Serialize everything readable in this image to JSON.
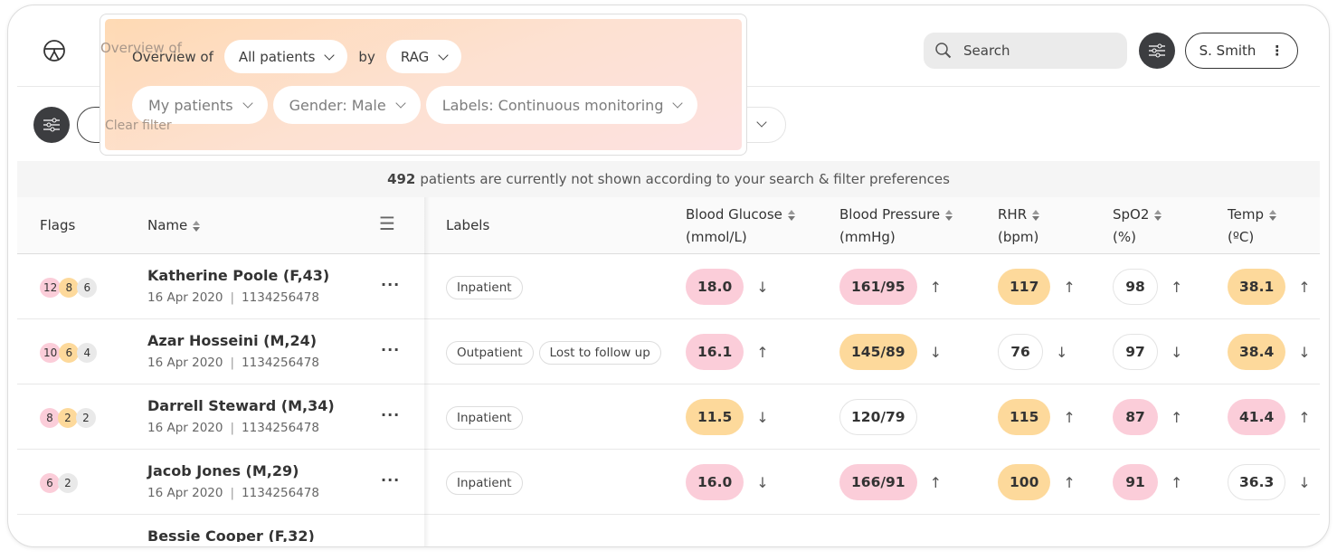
{
  "header": {
    "overview_label": "Overview of",
    "search_placeholder": "Search",
    "user": "S. Smith",
    "clear_filter": "Clear filter"
  },
  "overview": {
    "prefix": "Overview of",
    "scope": "All patients",
    "by": "by",
    "mode": "RAG",
    "filters": [
      "My patients",
      "Gender: Male",
      "Labels: Continuous monitoring"
    ]
  },
  "info": {
    "count": "492",
    "text": "patients are currently not shown according to your search & filter preferences"
  },
  "columns": {
    "flags": "Flags",
    "name": "Name",
    "labels": "Labels",
    "glucose": [
      "Blood Glucose",
      "(mmol/L)"
    ],
    "bp": [
      "Blood Pressure",
      "(mmHg)"
    ],
    "rhr": [
      "RHR",
      "(bpm)"
    ],
    "spo2": [
      "SpO2",
      "(%)"
    ],
    "temp": [
      "Temp",
      "(ºC)"
    ]
  },
  "colors": {
    "pink": "#fbcdd9",
    "orange": "#fdd99b",
    "gray": "#e9e9e9",
    "dark": "#3c3d40"
  },
  "patients": [
    {
      "name": "Katherine Poole (F,43)",
      "date": "16 Apr 2020",
      "id": "1134256478",
      "flags": [
        {
          "v": "12",
          "c": "pink"
        },
        {
          "v": "8",
          "c": "orange"
        },
        {
          "v": "6",
          "c": "gray"
        }
      ],
      "labels": [
        "Inpatient"
      ],
      "vitals": [
        {
          "v": "18.0",
          "c": "pink",
          "t": "↓"
        },
        {
          "v": "161/95",
          "c": "pink",
          "t": "↑"
        },
        {
          "v": "117",
          "c": "orange",
          "t": "↑"
        },
        {
          "v": "98",
          "c": "white",
          "t": "↑"
        },
        {
          "v": "38.1",
          "c": "orange",
          "t": "↑"
        }
      ]
    },
    {
      "name": "Azar Hosseini (M,24)",
      "date": "16 Apr 2020",
      "id": "1134256478",
      "flags": [
        {
          "v": "10",
          "c": "pink"
        },
        {
          "v": "6",
          "c": "orange"
        },
        {
          "v": "4",
          "c": "gray"
        }
      ],
      "labels": [
        "Outpatient",
        "Lost to follow up"
      ],
      "vitals": [
        {
          "v": "16.1",
          "c": "pink",
          "t": "↑"
        },
        {
          "v": "145/89",
          "c": "orange",
          "t": "↓"
        },
        {
          "v": "76",
          "c": "white",
          "t": "↓"
        },
        {
          "v": "97",
          "c": "white",
          "t": "↓"
        },
        {
          "v": "38.4",
          "c": "orange",
          "t": "↓"
        }
      ]
    },
    {
      "name": "Darrell Steward (M,34)",
      "date": "16 Apr 2020",
      "id": "1134256478",
      "flags": [
        {
          "v": "8",
          "c": "pink"
        },
        {
          "v": "2",
          "c": "orange"
        },
        {
          "v": "2",
          "c": "gray"
        }
      ],
      "labels": [
        "Inpatient"
      ],
      "vitals": [
        {
          "v": "11.5",
          "c": "orange",
          "t": "↓"
        },
        {
          "v": "120/79",
          "c": "white",
          "t": ""
        },
        {
          "v": "115",
          "c": "orange",
          "t": "↑"
        },
        {
          "v": "87",
          "c": "pink",
          "t": "↑"
        },
        {
          "v": "41.4",
          "c": "pink",
          "t": "↑"
        }
      ]
    },
    {
      "name": "Jacob Jones (M,29)",
      "date": "16 Apr 2020",
      "id": "1134256478",
      "flags": [
        {
          "v": "6",
          "c": "pink"
        },
        {
          "v": "2",
          "c": "gray"
        }
      ],
      "labels": [
        "Inpatient"
      ],
      "vitals": [
        {
          "v": "16.0",
          "c": "pink",
          "t": "↓"
        },
        {
          "v": "166/91",
          "c": "pink",
          "t": "↑"
        },
        {
          "v": "100",
          "c": "orange",
          "t": "↑"
        },
        {
          "v": "91",
          "c": "pink",
          "t": "↑"
        },
        {
          "v": "36.3",
          "c": "white",
          "t": "↓"
        }
      ]
    },
    {
      "name": "Bessie Cooper (F,32)",
      "date": "",
      "id": "",
      "flags": [],
      "labels": [],
      "vitals": []
    }
  ]
}
